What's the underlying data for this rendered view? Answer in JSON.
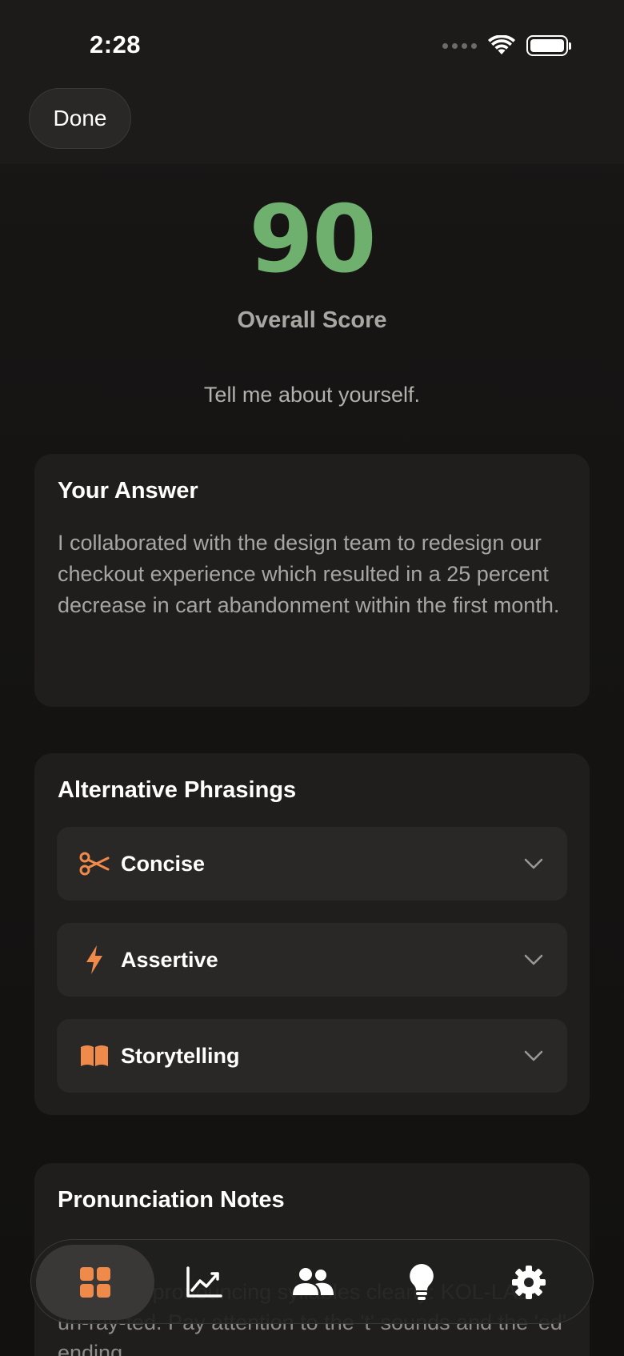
{
  "status_bar": {
    "time": "2:28"
  },
  "header": {
    "done_label": "Done"
  },
  "score": {
    "value": "90",
    "label": "Overall Score"
  },
  "question": "Tell me about yourself.",
  "answer": {
    "title": "Your Answer",
    "text": "I collaborated with the design team to redesign our checkout experience which resulted in a 25 percent decrease in cart abandonment within the first month."
  },
  "alternatives": {
    "title": "Alternative Phrasings",
    "items": [
      {
        "label": "Concise",
        "icon": "scissors-icon"
      },
      {
        "label": "Assertive",
        "icon": "lightning-icon"
      },
      {
        "label": "Storytelling",
        "icon": "book-icon"
      }
    ]
  },
  "pronunciation": {
    "title": "Pronunciation Notes",
    "text": "Focus on pronouncing syllables clearly: KOL-LAB-uh-ray-ted. Pay attention to the 't' sounds and the 'ed' ending"
  },
  "tabbar": {
    "items": [
      {
        "name": "dashboard",
        "icon": "grid-icon",
        "active": true
      },
      {
        "name": "progress",
        "icon": "chart-icon",
        "active": false
      },
      {
        "name": "people",
        "icon": "people-icon",
        "active": false
      },
      {
        "name": "tips",
        "icon": "lightbulb-icon",
        "active": false
      },
      {
        "name": "settings",
        "icon": "gear-icon",
        "active": false
      }
    ]
  },
  "colors": {
    "accent": "#f08a4b",
    "score": "#6fb06f",
    "background": "#141312",
    "card": "#1f1e1d"
  }
}
